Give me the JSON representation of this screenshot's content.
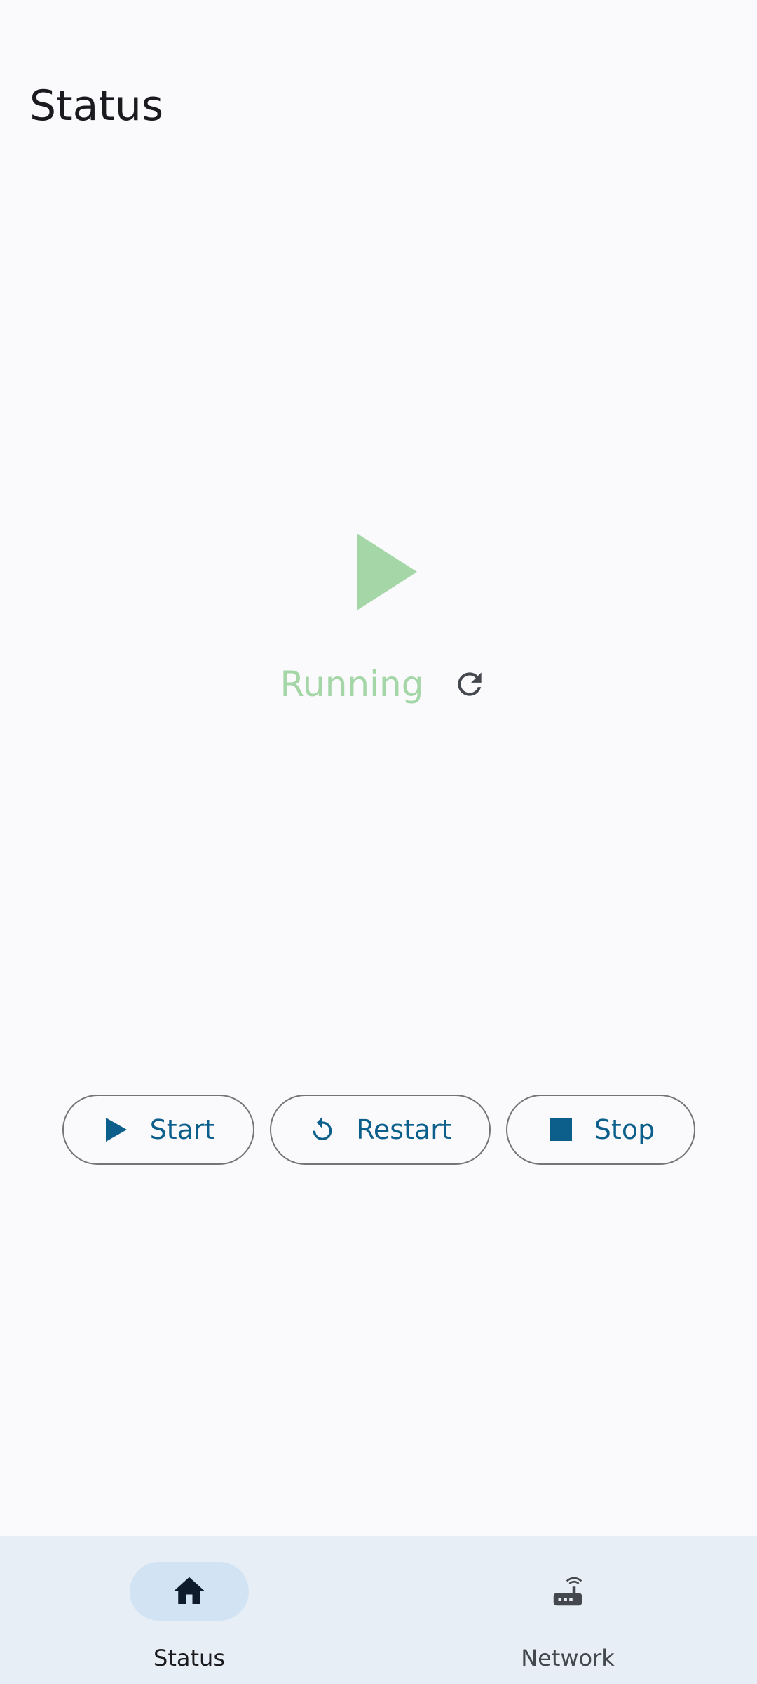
{
  "header": {
    "title": "Status"
  },
  "status": {
    "state_text": "Running",
    "state_icon": "play-triangle-icon",
    "refresh_icon": "refresh-icon",
    "running_color": "#a5d6a7"
  },
  "controls": {
    "start_label": "Start",
    "restart_label": "Restart",
    "stop_label": "Stop",
    "accent_color": "#0b5f8a"
  },
  "bottom_nav": {
    "items": [
      {
        "label": "Status",
        "icon": "home-icon",
        "selected": true
      },
      {
        "label": "Network",
        "icon": "router-icon",
        "selected": false
      }
    ]
  }
}
